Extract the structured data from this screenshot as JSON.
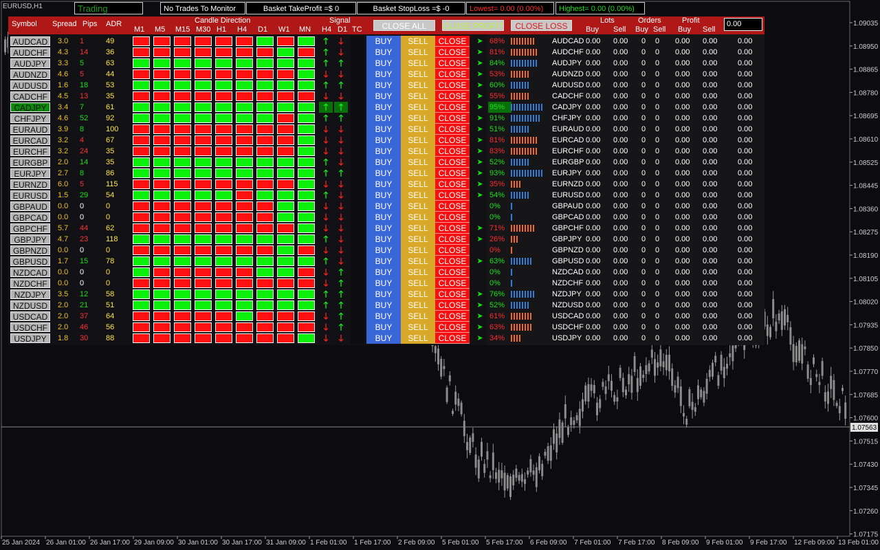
{
  "window": {
    "symbol_title": "EURUSD,H1"
  },
  "topbar": {
    "trading": "Trading",
    "no_trades": "No Trades To Monitor",
    "basket_tp": "Basket TakeProfit =$ 0",
    "basket_sl": "Basket StopLoss =$ -0",
    "lowest": "Lowest= 0.00 (0.00%)",
    "highest": "Highest= 0.00 (0.00%)"
  },
  "headers": {
    "symbol": "Symbol",
    "spread": "Spread",
    "pips": "Pips",
    "adr": "ADR",
    "candle_direction": "Candle Direction",
    "timeframes": [
      "M1",
      "M5",
      "M15",
      "M30",
      "H1",
      "H4",
      "D1",
      "W1",
      "MN"
    ],
    "signal": "Signal",
    "sig_h4": "H4",
    "sig_d1": "D1",
    "tc": "TC",
    "close_all": "CLOSE ALL",
    "close_profit": "CLOSE PROFIT",
    "close_loss": "CLOSE LOSS",
    "lots": "Lots",
    "orders": "Orders",
    "profit": "Profit",
    "buy": "Buy",
    "sell": "Sell",
    "input_value": "0.00"
  },
  "labels": {
    "buy": "BUY",
    "sell": "SELL",
    "close": "CLOSE",
    "zero": "0.00",
    "zero_int": "0",
    "exec_arrow": "➤"
  },
  "colors": {
    "header_bg": "#b01818",
    "buy_btn": "#3a67d8",
    "sell_btn": "#d9a828",
    "close_btn": "#f21010",
    "up": "#0af00a",
    "down": "#ff1010"
  },
  "rows": [
    {
      "sym": "AUDCAD",
      "spread": "3.0",
      "pips": "1",
      "adr": "49",
      "pips_color": "#ff3030",
      "cd": "DDDDDDUDU",
      "h4": "up",
      "d1": "dn",
      "arrow": true,
      "pct": "68%",
      "pc": "r",
      "bars": 9
    },
    {
      "sym": "AUDCHF",
      "spread": "4.3",
      "pips": "14",
      "adr": "36",
      "pips_color": "#ff3030",
      "cd": "DDDDDDDUD",
      "h4": "up",
      "d1": "dn",
      "arrow": true,
      "pct": "81%",
      "pc": "r",
      "bars": 10
    },
    {
      "sym": "AUDJPY",
      "spread": "3.3",
      "pips": "5",
      "adr": "63",
      "pips_color": "#19e019",
      "cd": "UUUUUUUUU",
      "h4": "up",
      "d1": "up",
      "arrow": true,
      "pct": "84%",
      "pc": "g",
      "bars": 10
    },
    {
      "sym": "AUDNZD",
      "spread": "4.6",
      "pips": "5",
      "adr": "44",
      "pips_color": "#ff3030",
      "cd": "DDDDDDDDU",
      "h4": "dn",
      "d1": "dn",
      "arrow": true,
      "pct": "53%",
      "pc": "r",
      "bars": 7
    },
    {
      "sym": "AUDUSD",
      "spread": "1.6",
      "pips": "18",
      "adr": "53",
      "pips_color": "#19e019",
      "cd": "UUUUUUUUU",
      "h4": "up",
      "d1": "up",
      "arrow": true,
      "pct": "60%",
      "pc": "g",
      "bars": 7
    },
    {
      "sym": "CADCHF",
      "spread": "4.5",
      "pips": "13",
      "adr": "35",
      "pips_color": "#ff3030",
      "cd": "DDDDDDDDD",
      "h4": "dn",
      "d1": "dn",
      "arrow": true,
      "pct": "55%",
      "pc": "r",
      "bars": 7
    },
    {
      "sym": "CADJPY",
      "spread": "3.4",
      "pips": "7",
      "adr": "61",
      "pips_color": "#19e019",
      "cd": "UUUUUUUUU",
      "h4": "up",
      "d1": "up",
      "arrow": true,
      "pct": "95%",
      "pc": "g",
      "bars": 12,
      "active": true
    },
    {
      "sym": "CHFJPY",
      "spread": "4.6",
      "pips": "52",
      "adr": "92",
      "pips_color": "#19e019",
      "cd": "UUUUUUUDU",
      "h4": "up",
      "d1": "up",
      "arrow": true,
      "pct": "91%",
      "pc": "g",
      "bars": 11
    },
    {
      "sym": "EURAUD",
      "spread": "3.9",
      "pips": "8",
      "adr": "100",
      "pips_color": "#19e019",
      "cd": "DDDDDDDDU",
      "h4": "dn",
      "d1": "dn",
      "arrow": true,
      "pct": "51%",
      "pc": "g",
      "bars": 7
    },
    {
      "sym": "EURCAD",
      "spread": "3.2",
      "pips": "4",
      "adr": "67",
      "pips_color": "#ff3030",
      "cd": "DDDDDDDDU",
      "h4": "dn",
      "d1": "dn",
      "arrow": true,
      "pct": "81%",
      "pc": "r",
      "bars": 10
    },
    {
      "sym": "EURCHF",
      "spread": "3.2",
      "pips": "24",
      "adr": "35",
      "pips_color": "#ff3030",
      "cd": "DDDDDDDDU",
      "h4": "dn",
      "d1": "dn",
      "arrow": true,
      "pct": "83%",
      "pc": "r",
      "bars": 10
    },
    {
      "sym": "EURGBP",
      "spread": "2.0",
      "pips": "14",
      "adr": "35",
      "pips_color": "#19e019",
      "cd": "UUUUUUUUU",
      "h4": "up",
      "d1": "dn",
      "arrow": true,
      "pct": "52%",
      "pc": "g",
      "bars": 7
    },
    {
      "sym": "EURJPY",
      "spread": "2.7",
      "pips": "8",
      "adr": "86",
      "pips_color": "#19e019",
      "cd": "UUUUUUUUU",
      "h4": "up",
      "d1": "up",
      "arrow": true,
      "pct": "93%",
      "pc": "g",
      "bars": 12
    },
    {
      "sym": "EURNZD",
      "spread": "6.0",
      "pips": "5",
      "adr": "115",
      "pips_color": "#ff3030",
      "cd": "DDDDDDDDU",
      "h4": "dn",
      "d1": "dn",
      "arrow": true,
      "pct": "35%",
      "pc": "r",
      "bars": 4
    },
    {
      "sym": "EURUSD",
      "spread": "1.5",
      "pips": "29",
      "adr": "54",
      "pips_color": "#19e019",
      "cd": "UUUUUDUUU",
      "h4": "up",
      "d1": "dn",
      "arrow": true,
      "pct": "54%",
      "pc": "g",
      "bars": 7
    },
    {
      "sym": "GBPAUD",
      "spread": "0.0",
      "pips": "0",
      "adr": "0",
      "pips_color": "#ffffff",
      "cd": "DDDDDDDUU",
      "h4": "dn",
      "d1": "dn",
      "arrow": false,
      "pct": "0%",
      "pc": "g",
      "bars": 1
    },
    {
      "sym": "GBPCAD",
      "spread": "0.0",
      "pips": "0",
      "adr": "0",
      "pips_color": "#ffffff",
      "cd": "DDDDDDDUU",
      "h4": "dn",
      "d1": "dn",
      "arrow": false,
      "pct": "0%",
      "pc": "g",
      "bars": 1
    },
    {
      "sym": "GBPCHF",
      "spread": "5.7",
      "pips": "44",
      "adr": "62",
      "pips_color": "#ff3030",
      "cd": "DDDDDDDDU",
      "h4": "dn",
      "d1": "dn",
      "arrow": true,
      "pct": "71%",
      "pc": "r",
      "bars": 9
    },
    {
      "sym": "GBPJPY",
      "spread": "4.7",
      "pips": "23",
      "adr": "118",
      "pips_color": "#ff3030",
      "cd": "UUUUUUUUU",
      "h4": "up",
      "d1": "dn",
      "arrow": true,
      "pct": "26%",
      "pc": "r",
      "bars": 3
    },
    {
      "sym": "GBPNZD",
      "spread": "0.0",
      "pips": "0",
      "adr": "0",
      "pips_color": "#ffffff",
      "cd": "DDDDDDDUD",
      "h4": "dn",
      "d1": "dn",
      "arrow": false,
      "pct": "0%",
      "pc": "r",
      "bars": 1
    },
    {
      "sym": "GBPUSD",
      "spread": "1.7",
      "pips": "15",
      "adr": "78",
      "pips_color": "#19e019",
      "cd": "UUUUUUUUU",
      "h4": "up",
      "d1": "dn",
      "arrow": true,
      "pct": "63%",
      "pc": "g",
      "bars": 8
    },
    {
      "sym": "NZDCAD",
      "spread": "0.0",
      "pips": "0",
      "adr": "0",
      "pips_color": "#ffffff",
      "cd": "UDDDDDUUD",
      "h4": "dn",
      "d1": "up",
      "arrow": false,
      "pct": "0%",
      "pc": "g",
      "bars": 1
    },
    {
      "sym": "NZDCHF",
      "spread": "0.0",
      "pips": "0",
      "adr": "0",
      "pips_color": "#ffffff",
      "cd": "DDDDDDDDD",
      "h4": "dn",
      "d1": "up",
      "arrow": false,
      "pct": "0%",
      "pc": "g",
      "bars": 1
    },
    {
      "sym": "NZDJPY",
      "spread": "3.5",
      "pips": "12",
      "adr": "58",
      "pips_color": "#19e019",
      "cd": "UUUUUUUUU",
      "h4": "up",
      "d1": "up",
      "arrow": true,
      "pct": "76%",
      "pc": "g",
      "bars": 9
    },
    {
      "sym": "NZDUSD",
      "spread": "2.0",
      "pips": "21",
      "adr": "51",
      "pips_color": "#19e019",
      "cd": "UUUUUUUUU",
      "h4": "up",
      "d1": "up",
      "arrow": true,
      "pct": "52%",
      "pc": "g",
      "bars": 7
    },
    {
      "sym": "USDCAD",
      "spread": "2.0",
      "pips": "37",
      "adr": "64",
      "pips_color": "#ff3030",
      "cd": "DDDDDUDDD",
      "h4": "dn",
      "d1": "up",
      "arrow": true,
      "pct": "61%",
      "pc": "r",
      "bars": 8
    },
    {
      "sym": "USDCHF",
      "spread": "2.0",
      "pips": "46",
      "adr": "56",
      "pips_color": "#ff3030",
      "cd": "DDDDDDDDD",
      "h4": "dn",
      "d1": "up",
      "arrow": true,
      "pct": "63%",
      "pc": "r",
      "bars": 8
    },
    {
      "sym": "USDJPY",
      "spread": "1.8",
      "pips": "30",
      "adr": "88",
      "pips_color": "#ff3030",
      "cd": "DDDDDDDDU",
      "h4": "dn",
      "d1": "dn",
      "arrow": true,
      "pct": "34%",
      "pc": "r",
      "bars": 4
    }
  ],
  "chart": {
    "price_labels": [
      "1.09035",
      "1.08950",
      "1.08865",
      "1.08780",
      "1.08695",
      "1.08610",
      "1.08525",
      "1.08445",
      "1.08360",
      "1.08275",
      "1.08190",
      "1.08105",
      "1.08020",
      "1.07935",
      "1.07850",
      "1.07770",
      "1.07685",
      "1.07600",
      "1.07515",
      "1.07430",
      "1.07345",
      "1.07260",
      "1.07175"
    ],
    "current_price": "1.07563",
    "time_labels": [
      "25 Jan 2024",
      "26 Jan 01:00",
      "26 Jan 17:00",
      "29 Jan 09:00",
      "30 Jan 01:00",
      "30 Jan 17:00",
      "31 Jan 09:00",
      "1 Feb 01:00",
      "1 Feb 17:00",
      "2 Feb 09:00",
      "5 Feb 01:00",
      "5 Feb 17:00",
      "6 Feb 09:00",
      "7 Feb 01:00",
      "7 Feb 17:00",
      "8 Feb 09:00",
      "9 Feb 01:00",
      "9 Feb 17:00",
      "12 Feb 09:00",
      "13 Feb 01:00"
    ]
  }
}
